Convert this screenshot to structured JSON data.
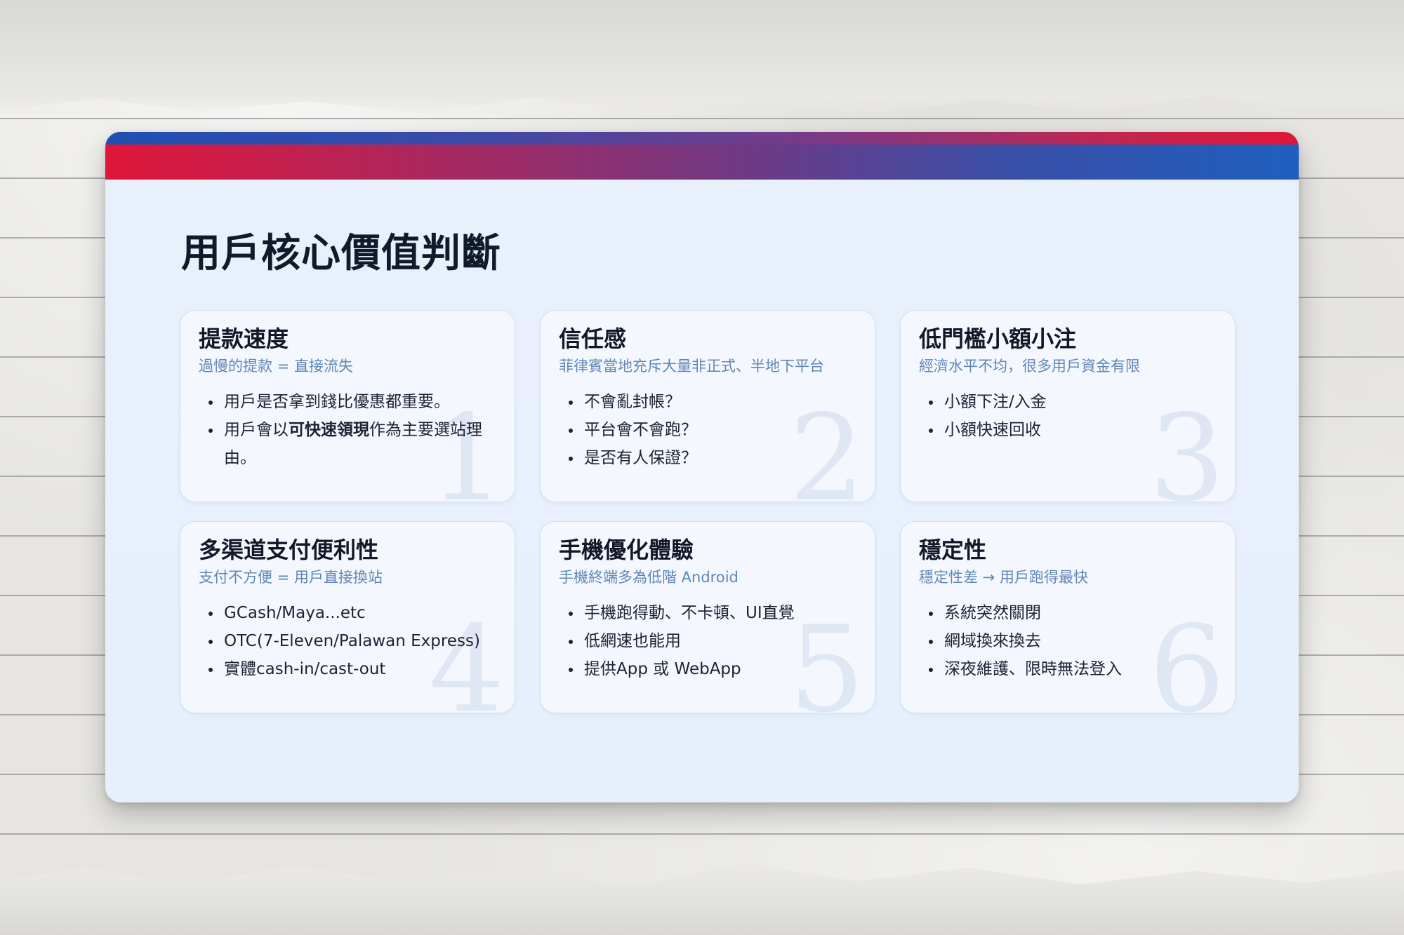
{
  "slide": {
    "title": "用戶核心價值判斷",
    "colors": {
      "accent_red": "#e0163a",
      "accent_blue": "#1f5fbf",
      "subtitle": "#5f86b8",
      "card_bg": "#f4f8fe"
    }
  },
  "cards": [
    {
      "number": "1",
      "title": "提款速度",
      "subtitle": "過慢的提款 = 直接流失",
      "item1": "用戶是否拿到錢比優惠都重要。",
      "item2_pre": "用戶會以",
      "item2_bold": "可快速領現",
      "item2_post": "作為主要選站理由。"
    },
    {
      "number": "2",
      "title": "信任感",
      "subtitle": "菲律賓當地充斥大量非正式、半地下平台",
      "items": [
        "不會亂封帳？",
        "平台會不會跑？",
        "是否有人保證？"
      ]
    },
    {
      "number": "3",
      "title": "低門檻小額小注",
      "subtitle": "經濟水平不均，很多用戶資金有限",
      "items": [
        "小額下注/入金",
        "小額快速回收"
      ]
    },
    {
      "number": "4",
      "title": "多渠道支付便利性",
      "subtitle": "支付不方便 = 用戶直接換站",
      "items": [
        "GCash/Maya...etc",
        "OTC(7-Eleven/Palawan Express)",
        "實體cash-in/cast-out"
      ]
    },
    {
      "number": "5",
      "title": "手機優化體驗",
      "subtitle": "手機終端多為低階 Android",
      "items": [
        "手機跑得動、不卡頓、UI直覺",
        "低網速也能用",
        "提供App 或 WebApp"
      ]
    },
    {
      "number": "6",
      "title": "穩定性",
      "subtitle": "穩定性差 → 用戶跑得最快",
      "items": [
        "系統突然關閉",
        "網域換來換去",
        "深夜維護、限時無法登入"
      ]
    }
  ]
}
